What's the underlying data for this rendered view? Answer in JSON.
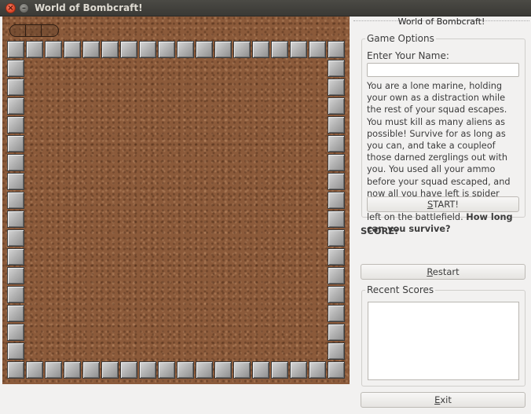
{
  "window": {
    "title": "World of Bombcraft!",
    "close_glyph": "×",
    "minimize_glyph": "–"
  },
  "panel": {
    "header": "World of Bombcraft!",
    "game_options": {
      "title": "Game Options",
      "name_label": "Enter Your Name:",
      "name_value": "",
      "description": "You are a lone marine, holding your own as a distraction while the rest of your squad escapes. You must kill as many aliens as possible! Survive for as long as you can, and take a coupleof those darned zerglings out with you. You used all your ammo before your squad escaped, and now all you have left is spider mines and the ocassional missile left on the battlefield.",
      "description_bold": "How long can you survive?",
      "start_label_mnemonic": "S",
      "start_label_rest": "TART!"
    },
    "score": {
      "label": "SCORE:",
      "value": ""
    },
    "restart_mnemonic": "R",
    "restart_rest": "estart",
    "recent_scores": {
      "title": "Recent Scores",
      "entries": []
    },
    "exit_mnemonic": "E",
    "exit_rest": "xit"
  },
  "game": {
    "wall_tile_icon": "stone-block-icon",
    "floor": "dirt-texture",
    "colors": {
      "floor": "#8b5a3a",
      "wall": "#b4b4b4",
      "titlebar": "#3f3e3a",
      "close_button": "#df4a2b"
    }
  }
}
